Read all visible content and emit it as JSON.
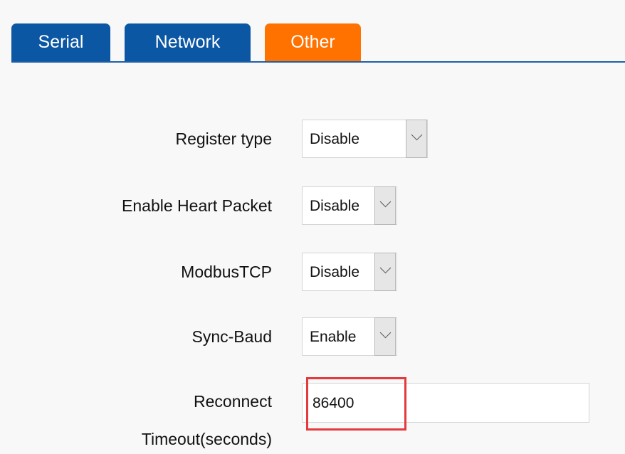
{
  "tabs": {
    "serial": "Serial",
    "network": "Network",
    "other": "Other"
  },
  "fields": {
    "register_type": {
      "label": "Register type",
      "value": "Disable"
    },
    "enable_heart_packet": {
      "label": "Enable Heart Packet",
      "value": "Disable"
    },
    "modbus_tcp": {
      "label": "ModbusTCP",
      "value": "Disable"
    },
    "sync_baud": {
      "label": "Sync-Baud",
      "value": "Enable"
    },
    "reconnect_timeout": {
      "label_line_1": "Reconnect",
      "label_line_2": "Timeout(seconds)",
      "value": "86400"
    }
  },
  "icons": {
    "dropdown": "chevron-down-icon"
  },
  "colors": {
    "tab_blue": "#0b57a4",
    "tab_active_orange": "#ff7200",
    "highlight_red": "#e53a3d"
  }
}
